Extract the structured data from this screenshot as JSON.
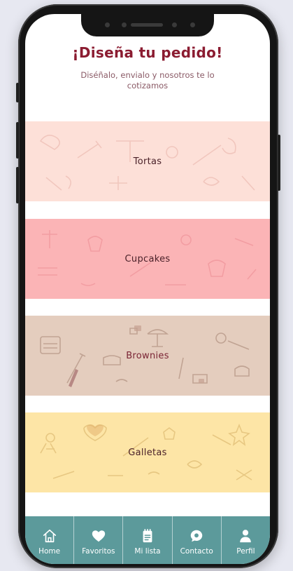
{
  "header": {
    "title": "¡Diseña tu pedido!",
    "subtitle": "Diséñalo, envialo y nosotros te lo cotizamos"
  },
  "categories": [
    {
      "label": "Tortas",
      "color": "#fde0d8"
    },
    {
      "label": "Cupcakes",
      "color": "#fbb4b6"
    },
    {
      "label": "Brownies",
      "color": "#e4cdbe"
    },
    {
      "label": "Galletas",
      "color": "#fde5a6"
    }
  ],
  "bottom_nav": {
    "background": "#5c9a9b",
    "items": [
      {
        "label": "Home",
        "icon": "home-icon"
      },
      {
        "label": "Favoritos",
        "icon": "heart-icon"
      },
      {
        "label": "Mi lista",
        "icon": "notepad-icon"
      },
      {
        "label": "Contacto",
        "icon": "chat-bubble-icon"
      },
      {
        "label": "Perfil",
        "icon": "user-icon"
      }
    ]
  },
  "colors": {
    "title": "#8b1c31",
    "page_background": "#e7e8f1"
  }
}
